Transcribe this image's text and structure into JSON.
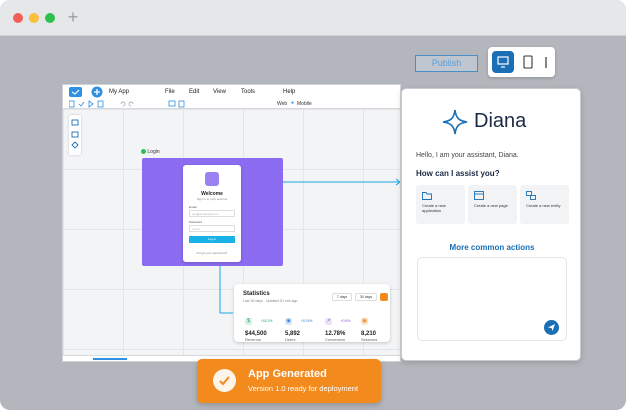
{
  "window": {
    "title_plus": "+"
  },
  "header": {
    "publish_label": "Publish",
    "device_buttons": [
      "desktop-icon",
      "tablet-icon",
      "mobile-icon"
    ]
  },
  "editor": {
    "app_name": "My App",
    "menu": [
      "File",
      "Edit",
      "View",
      "Tools",
      "Help"
    ],
    "toolbar": {
      "web_label": "Web",
      "mobile_label": "Mobile"
    },
    "login_tag": "Login",
    "login_card": {
      "title": "Welcome",
      "subtitle": "Sign in to your account",
      "email_label": "Email",
      "email_placeholder": "you@company.com",
      "password_label": "Password",
      "password_placeholder": "••••••••",
      "button": "Log in",
      "forgot": "Forgot your password?"
    },
    "stats": {
      "title": "Statistics",
      "subtitle": "Last 30 days · Updated 51 min ago",
      "ranges": [
        "7 days",
        "30 days"
      ],
      "items": [
        {
          "icon": "$",
          "delta": "+18.2%",
          "value": "$44,500",
          "label": "Revenue",
          "color": "#1aa86b"
        },
        {
          "icon": "◉",
          "delta": "+10.5%",
          "value": "5,892",
          "label": "Users",
          "color": "#2f7be0"
        },
        {
          "icon": "↗",
          "delta": "+0.8%",
          "value": "12.78%",
          "label": "Conversion",
          "color": "#8b57d9"
        },
        {
          "icon": "▣",
          "delta": "",
          "value": "8,210",
          "label": "Sessions",
          "color": "#f28a1e"
        }
      ]
    }
  },
  "assistant": {
    "name": "Diana",
    "greeting": "Hello, I am your assistant, Diana.",
    "question": "How can I assist you?",
    "actions": [
      {
        "icon": "folder-icon",
        "label": "Create a new application"
      },
      {
        "icon": "page-icon",
        "label": "Create a new page"
      },
      {
        "icon": "entity-icon",
        "label": "Create a new entity"
      }
    ],
    "more_actions": "More common actions",
    "colors": {
      "accent": "#1a6fb5",
      "title": "#1b2a44"
    }
  },
  "toast": {
    "title": "App Generated",
    "subtitle": "Version 1.0 ready for deployment",
    "color": "#f28a1e"
  }
}
